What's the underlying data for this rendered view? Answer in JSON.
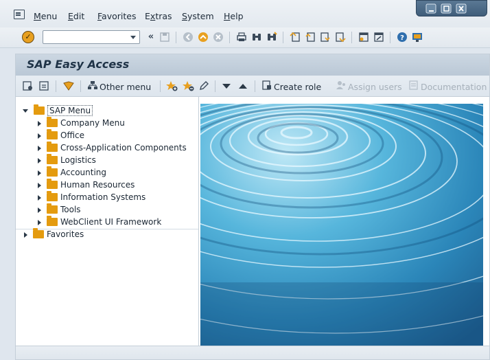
{
  "menubar": {
    "items": [
      {
        "label": "Menu",
        "accel": "M",
        "rest": "enu"
      },
      {
        "label": "Edit",
        "accel": "E",
        "rest": "dit"
      },
      {
        "label": "Favorites",
        "accel": "F",
        "rest": "avorites"
      },
      {
        "label": "Extras",
        "accel": "x",
        "pre": "E",
        "rest": "tras"
      },
      {
        "label": "System",
        "accel": "S",
        "rest": "ystem"
      },
      {
        "label": "Help",
        "accel": "H",
        "rest": "elp"
      }
    ]
  },
  "command_field": {
    "value": ""
  },
  "title": "SAP Easy Access",
  "app_toolbar": {
    "other_menu": "Other menu",
    "create_role": "Create role",
    "assign_users": "Assign users",
    "documentation": "Documentation"
  },
  "tree": {
    "root": "SAP Menu",
    "children": [
      "Company Menu",
      "Office",
      "Cross-Application Components",
      "Logistics",
      "Accounting",
      "Human Resources",
      "Information Systems",
      "Tools",
      "WebClient UI Framework"
    ],
    "favorites": "Favorites"
  },
  "colors": {
    "folder": "#e49b0f",
    "accent": "#e8a020",
    "window_controls": "#4a6885"
  }
}
